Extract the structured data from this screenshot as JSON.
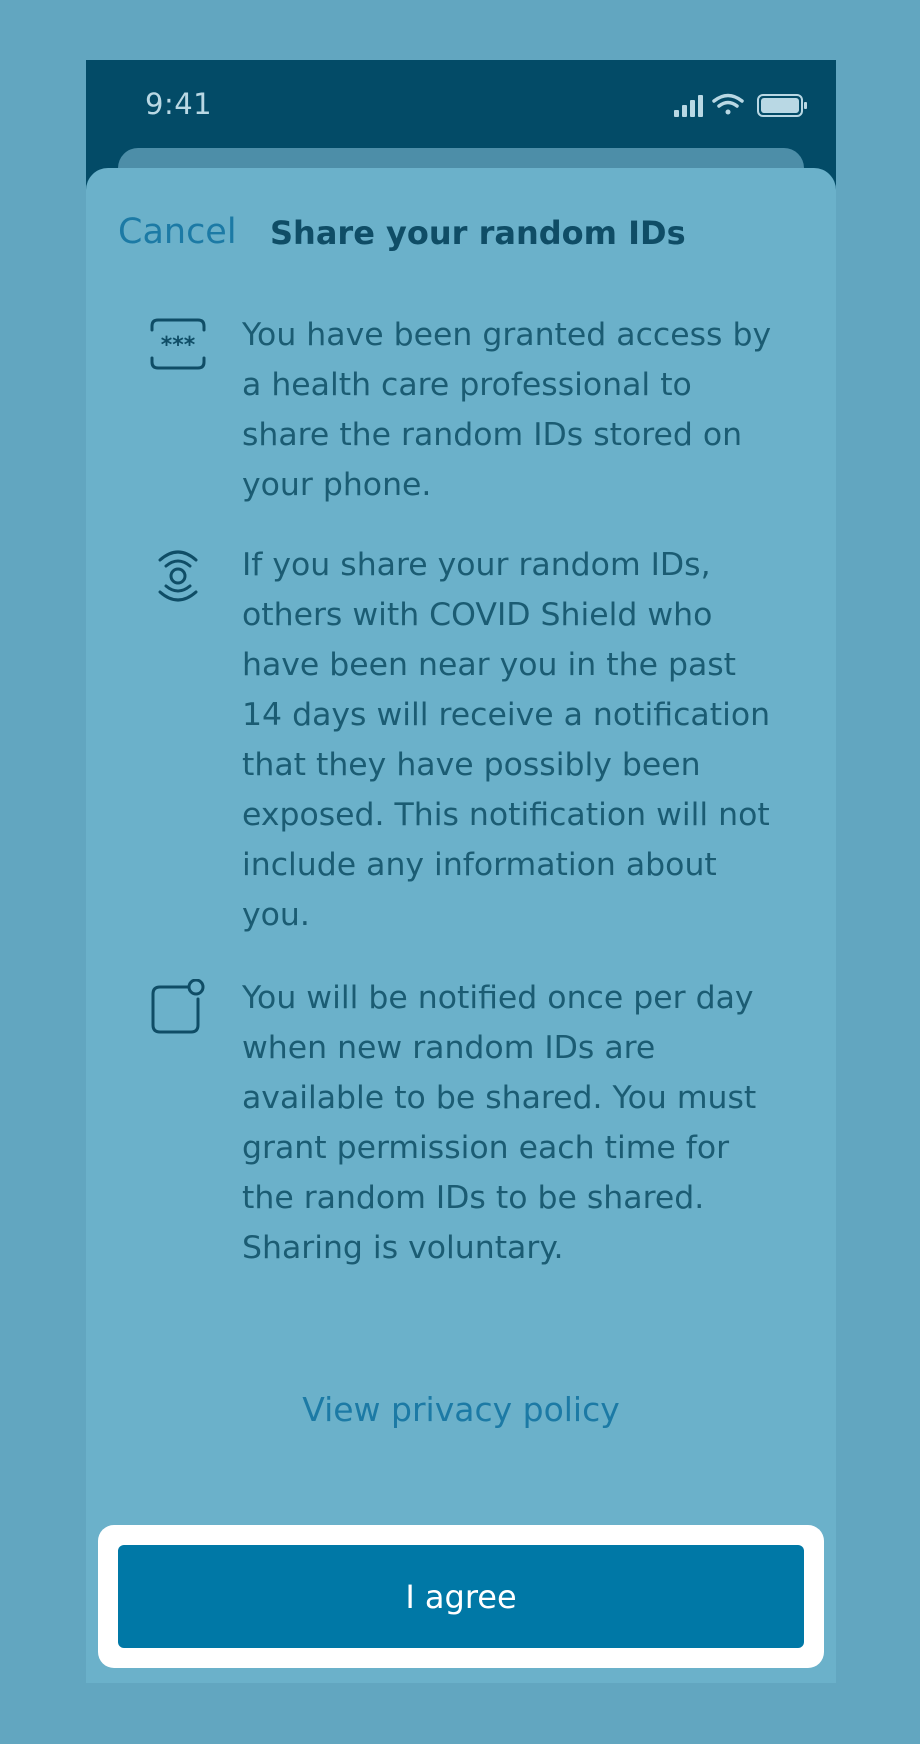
{
  "status_bar": {
    "time": "9:41",
    "icons": [
      "signal-icon",
      "wifi-icon",
      "battery-icon"
    ]
  },
  "header": {
    "cancel_label": "Cancel",
    "title": "Share your random IDs"
  },
  "items": [
    {
      "icon": "password-icon",
      "text": "You have been granted access by a health care professional to share the random IDs stored on your phone."
    },
    {
      "icon": "broadcast-icon",
      "text": "If you share your random IDs, others with COVID Shield who have been near you in the past 14 days will receive a notification that they have possibly been exposed. This notification will not include any information about you."
    },
    {
      "icon": "notification-badge-icon",
      "text": "You will be notified once per day when new random IDs are available to be shared. You must grant permission each time for the random IDs to be shared. Sharing is voluntary."
    }
  ],
  "privacy_link_label": "View privacy policy",
  "agree_button_label": "I agree",
  "colors": {
    "background": "#62a6c0",
    "status_bar": "#034b67",
    "sheet": "#6bb1ca",
    "link": "#1c7aa5",
    "primary_button": "#0078a6",
    "text": "#1b5c73"
  }
}
